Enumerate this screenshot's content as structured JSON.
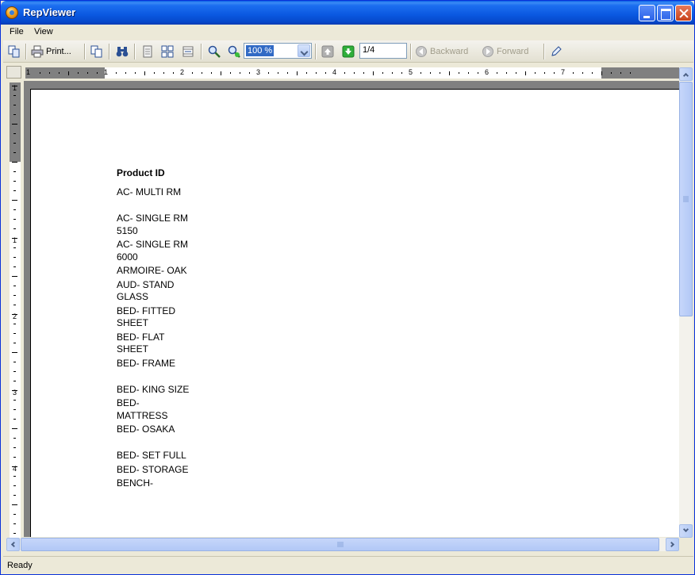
{
  "window": {
    "title": "RepViewer"
  },
  "menu": {
    "items": [
      "File",
      "View"
    ]
  },
  "toolbar": {
    "print_label": "Print...",
    "zoom_value": "100 %",
    "page_value": "1/4",
    "backward_label": "Backward",
    "forward_label": "Forward"
  },
  "ruler": {
    "h_numbers": [
      "1",
      "1",
      "2",
      "3",
      "4",
      "5",
      "6",
      "7"
    ],
    "v_numbers": [
      "1",
      "1",
      "2",
      "3",
      "4"
    ]
  },
  "report": {
    "header": "Product ID",
    "products": [
      "AC- MULTI RM",
      "AC- SINGLE RM 5150",
      "AC- SINGLE RM 6000",
      "ARMOIRE- OAK",
      "AUD- STAND GLASS",
      "BED- FITTED SHEET",
      "BED- FLAT SHEET",
      "BED- FRAME",
      "BED- KING SIZE",
      "BED- MATTRESS",
      "BED- OSAKA",
      "BED- SET FULL",
      "BED- STORAGE",
      "BENCH-"
    ]
  },
  "status": {
    "text": "Ready"
  },
  "icons": [
    "app-icon",
    "copy-page-icon",
    "printer-icon",
    "copy-icon",
    "binoculars-icon",
    "single-page-icon",
    "multi-page-icon",
    "page-setup-icon",
    "zoom-in-icon",
    "zoom-out-icon",
    "previous-page-icon",
    "next-page-icon",
    "backward-icon",
    "forward-icon",
    "edit-icon"
  ]
}
